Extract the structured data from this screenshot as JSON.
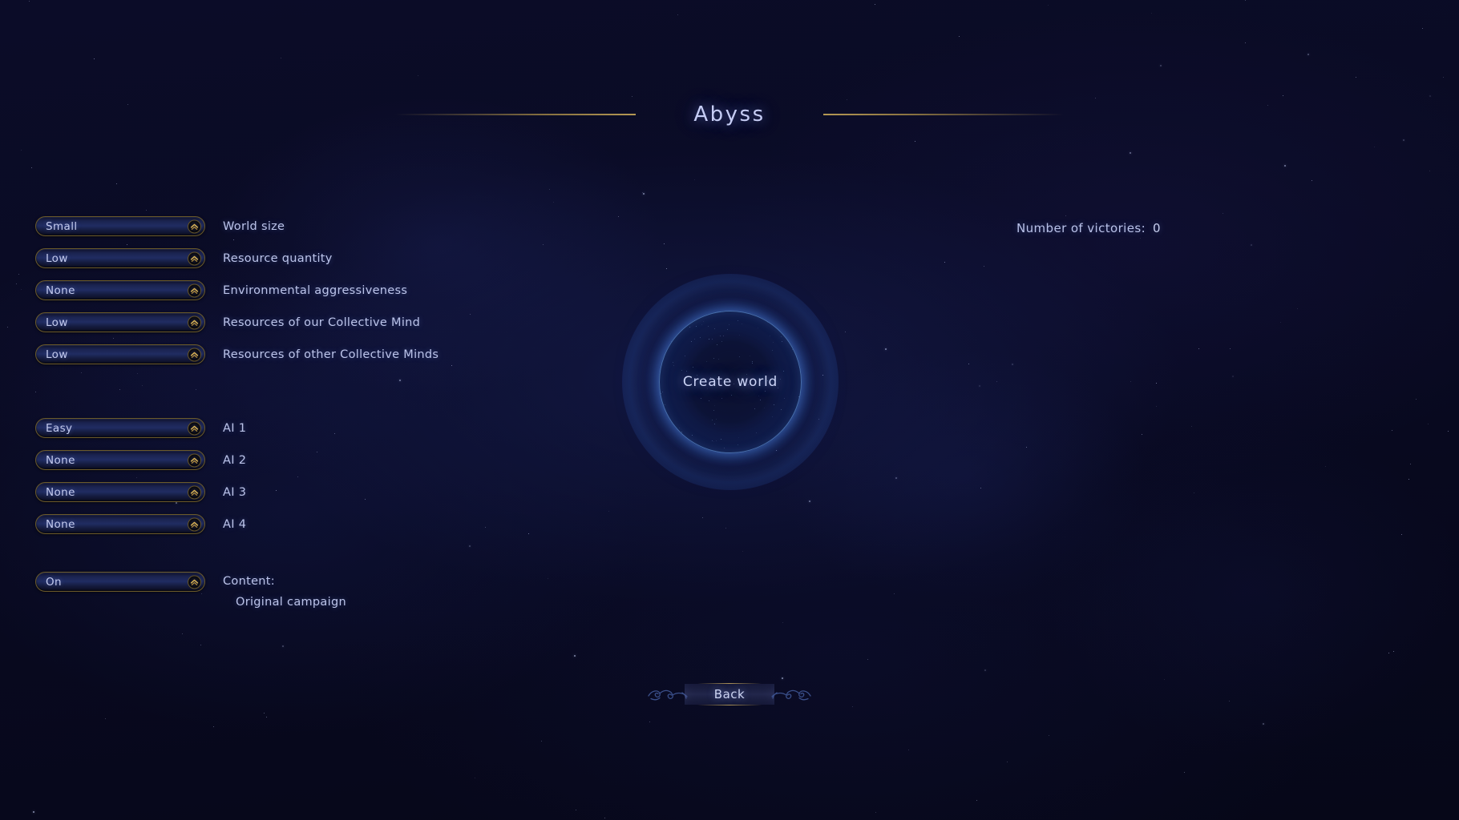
{
  "title": "Abyss",
  "world_settings": [
    {
      "value": "Small",
      "label": "World size"
    },
    {
      "value": "Low",
      "label": "Resource quantity"
    },
    {
      "value": "None",
      "label": "Environmental aggressiveness"
    },
    {
      "value": "Low",
      "label": "Resources of our Collective Mind"
    },
    {
      "value": "Low",
      "label": "Resources of other Collective Minds"
    }
  ],
  "ai_settings": [
    {
      "value": "Easy",
      "label": "AI 1"
    },
    {
      "value": "None",
      "label": "AI 2"
    },
    {
      "value": "None",
      "label": "AI 3"
    },
    {
      "value": "None",
      "label": "AI 4"
    }
  ],
  "content": {
    "value": "On",
    "heading": "Content:",
    "entry": "Original campaign"
  },
  "victories": {
    "label": "Number of victories:",
    "count": "0"
  },
  "create_world": {
    "label": "Create world"
  },
  "back": {
    "label": "Back"
  },
  "colors": {
    "background": "#0a0b24",
    "title_text": "#c6cdf5",
    "label_text": "#bcc4ea",
    "dropdown_border": "#6b5a2a",
    "dropdown_arrow": "#d8b254",
    "rule_gold": "#be a056",
    "globe_rim": "#78b4ff"
  }
}
